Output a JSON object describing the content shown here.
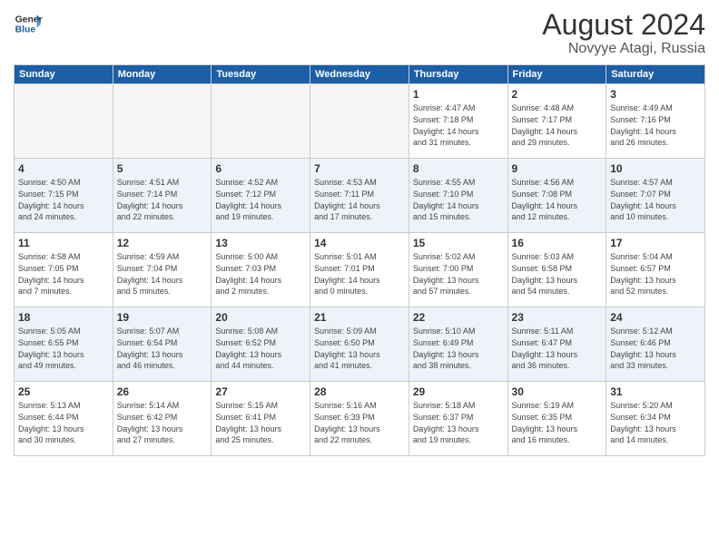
{
  "header": {
    "logo_line1": "General",
    "logo_line2": "Blue",
    "month": "August 2024",
    "location": "Novyye Atagi, Russia"
  },
  "weekdays": [
    "Sunday",
    "Monday",
    "Tuesday",
    "Wednesday",
    "Thursday",
    "Friday",
    "Saturday"
  ],
  "weeks": [
    [
      {
        "day": "",
        "info": ""
      },
      {
        "day": "",
        "info": ""
      },
      {
        "day": "",
        "info": ""
      },
      {
        "day": "",
        "info": ""
      },
      {
        "day": "1",
        "info": "Sunrise: 4:47 AM\nSunset: 7:18 PM\nDaylight: 14 hours\nand 31 minutes."
      },
      {
        "day": "2",
        "info": "Sunrise: 4:48 AM\nSunset: 7:17 PM\nDaylight: 14 hours\nand 29 minutes."
      },
      {
        "day": "3",
        "info": "Sunrise: 4:49 AM\nSunset: 7:16 PM\nDaylight: 14 hours\nand 26 minutes."
      }
    ],
    [
      {
        "day": "4",
        "info": "Sunrise: 4:50 AM\nSunset: 7:15 PM\nDaylight: 14 hours\nand 24 minutes."
      },
      {
        "day": "5",
        "info": "Sunrise: 4:51 AM\nSunset: 7:14 PM\nDaylight: 14 hours\nand 22 minutes."
      },
      {
        "day": "6",
        "info": "Sunrise: 4:52 AM\nSunset: 7:12 PM\nDaylight: 14 hours\nand 19 minutes."
      },
      {
        "day": "7",
        "info": "Sunrise: 4:53 AM\nSunset: 7:11 PM\nDaylight: 14 hours\nand 17 minutes."
      },
      {
        "day": "8",
        "info": "Sunrise: 4:55 AM\nSunset: 7:10 PM\nDaylight: 14 hours\nand 15 minutes."
      },
      {
        "day": "9",
        "info": "Sunrise: 4:56 AM\nSunset: 7:08 PM\nDaylight: 14 hours\nand 12 minutes."
      },
      {
        "day": "10",
        "info": "Sunrise: 4:57 AM\nSunset: 7:07 PM\nDaylight: 14 hours\nand 10 minutes."
      }
    ],
    [
      {
        "day": "11",
        "info": "Sunrise: 4:58 AM\nSunset: 7:05 PM\nDaylight: 14 hours\nand 7 minutes."
      },
      {
        "day": "12",
        "info": "Sunrise: 4:59 AM\nSunset: 7:04 PM\nDaylight: 14 hours\nand 5 minutes."
      },
      {
        "day": "13",
        "info": "Sunrise: 5:00 AM\nSunset: 7:03 PM\nDaylight: 14 hours\nand 2 minutes."
      },
      {
        "day": "14",
        "info": "Sunrise: 5:01 AM\nSunset: 7:01 PM\nDaylight: 14 hours\nand 0 minutes."
      },
      {
        "day": "15",
        "info": "Sunrise: 5:02 AM\nSunset: 7:00 PM\nDaylight: 13 hours\nand 57 minutes."
      },
      {
        "day": "16",
        "info": "Sunrise: 5:03 AM\nSunset: 6:58 PM\nDaylight: 13 hours\nand 54 minutes."
      },
      {
        "day": "17",
        "info": "Sunrise: 5:04 AM\nSunset: 6:57 PM\nDaylight: 13 hours\nand 52 minutes."
      }
    ],
    [
      {
        "day": "18",
        "info": "Sunrise: 5:05 AM\nSunset: 6:55 PM\nDaylight: 13 hours\nand 49 minutes."
      },
      {
        "day": "19",
        "info": "Sunrise: 5:07 AM\nSunset: 6:54 PM\nDaylight: 13 hours\nand 46 minutes."
      },
      {
        "day": "20",
        "info": "Sunrise: 5:08 AM\nSunset: 6:52 PM\nDaylight: 13 hours\nand 44 minutes."
      },
      {
        "day": "21",
        "info": "Sunrise: 5:09 AM\nSunset: 6:50 PM\nDaylight: 13 hours\nand 41 minutes."
      },
      {
        "day": "22",
        "info": "Sunrise: 5:10 AM\nSunset: 6:49 PM\nDaylight: 13 hours\nand 38 minutes."
      },
      {
        "day": "23",
        "info": "Sunrise: 5:11 AM\nSunset: 6:47 PM\nDaylight: 13 hours\nand 36 minutes."
      },
      {
        "day": "24",
        "info": "Sunrise: 5:12 AM\nSunset: 6:46 PM\nDaylight: 13 hours\nand 33 minutes."
      }
    ],
    [
      {
        "day": "25",
        "info": "Sunrise: 5:13 AM\nSunset: 6:44 PM\nDaylight: 13 hours\nand 30 minutes."
      },
      {
        "day": "26",
        "info": "Sunrise: 5:14 AM\nSunset: 6:42 PM\nDaylight: 13 hours\nand 27 minutes."
      },
      {
        "day": "27",
        "info": "Sunrise: 5:15 AM\nSunset: 6:41 PM\nDaylight: 13 hours\nand 25 minutes."
      },
      {
        "day": "28",
        "info": "Sunrise: 5:16 AM\nSunset: 6:39 PM\nDaylight: 13 hours\nand 22 minutes."
      },
      {
        "day": "29",
        "info": "Sunrise: 5:18 AM\nSunset: 6:37 PM\nDaylight: 13 hours\nand 19 minutes."
      },
      {
        "day": "30",
        "info": "Sunrise: 5:19 AM\nSunset: 6:35 PM\nDaylight: 13 hours\nand 16 minutes."
      },
      {
        "day": "31",
        "info": "Sunrise: 5:20 AM\nSunset: 6:34 PM\nDaylight: 13 hours\nand 14 minutes."
      }
    ]
  ]
}
